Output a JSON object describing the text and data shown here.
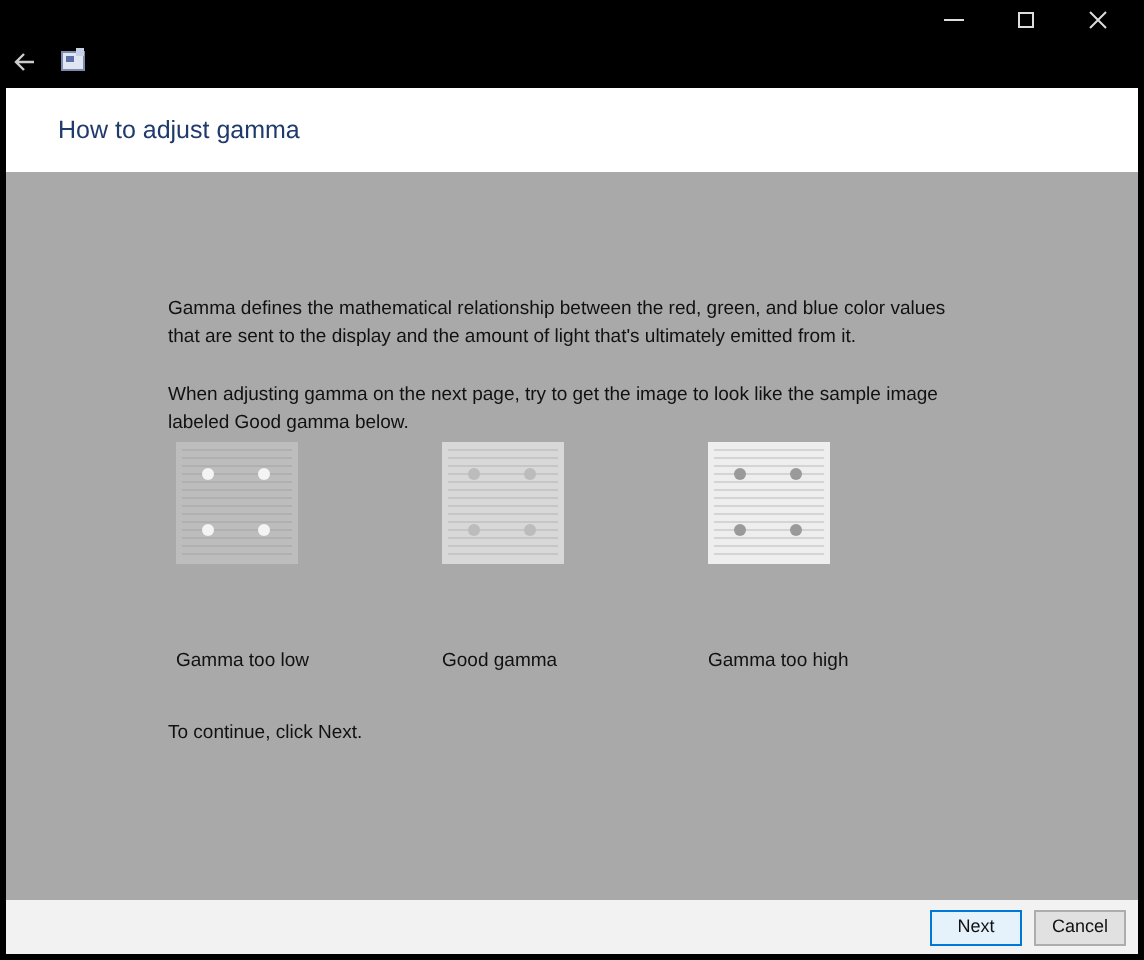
{
  "window": {
    "title": "How to adjust gamma"
  },
  "paragraphs": [
    "Gamma defines the mathematical relationship between the red, green, and blue color values that are sent to the display and the amount of light that's ultimately emitted from it.",
    "When adjusting gamma on the next page, try to get the image to look like the sample image labeled Good gamma below."
  ],
  "samples": [
    {
      "kind": "low",
      "label": "Gamma too low"
    },
    {
      "kind": "good",
      "label": "Good gamma"
    },
    {
      "kind": "high",
      "label": "Gamma too high"
    }
  ],
  "instruction": "To continue, click Next.",
  "buttons": [
    {
      "label": "Next",
      "selected": true
    },
    {
      "label": "Cancel",
      "selected": false
    }
  ]
}
